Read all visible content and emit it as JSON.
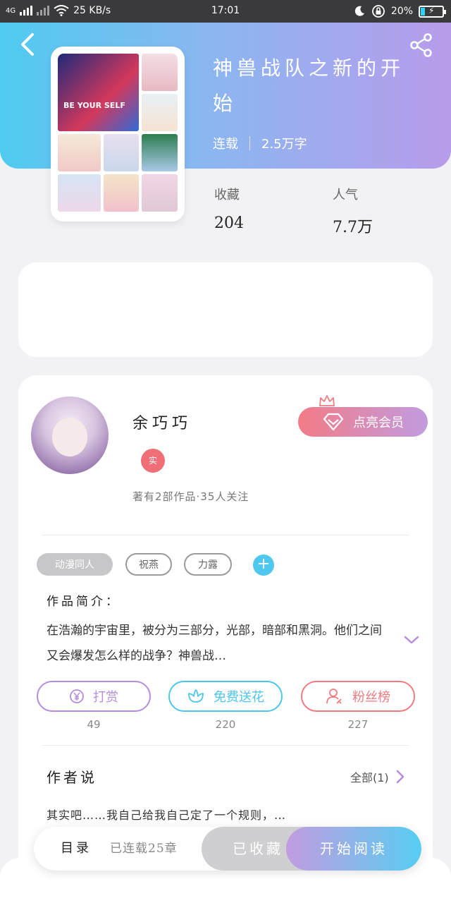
{
  "status_bar": {
    "network": "4G",
    "speed": "25 KB/s",
    "time": "17:01",
    "battery": "20%",
    "battery_level": 0.2
  },
  "book": {
    "title": "神兽战队之新的开始",
    "status": "连载",
    "word_count": "2.5万字",
    "cover_text": "BE YOUR SELF"
  },
  "stats": {
    "favorites_label": "收藏",
    "favorites_value": "204",
    "popularity_label": "人气",
    "popularity_value": "7.7万"
  },
  "author": {
    "name": "余巧巧",
    "badge": "实",
    "summary": "著有2部作品·35人关注",
    "vip_button": "点亮会员"
  },
  "tags": [
    "动漫同人",
    "祝燕",
    "力露"
  ],
  "intro": {
    "label": "作品简介：",
    "text": "在浩瀚的宇宙里，被分为三部分，光部，暗部和黑洞。他们之间又会爆发怎么样的战争？神兽战…"
  },
  "actions": [
    {
      "label": "打赏",
      "count": "49",
      "color": "#b58ddc",
      "icon": "yen-coin-icon"
    },
    {
      "label": "免费送花",
      "count": "220",
      "color": "#4cc6ea",
      "icon": "flower-icon"
    },
    {
      "label": "粉丝榜",
      "count": "227",
      "color": "#ef7b82",
      "icon": "fan-icon"
    }
  ],
  "author_says": {
    "title": "作者说",
    "all_label": "全部(1)",
    "text": "其实吧……我自己给我自己定了一个规则，…"
  },
  "bottom_bar": {
    "toc": "目录",
    "chapters": "已连载25章",
    "collected": "已收藏",
    "read": "开始阅读"
  },
  "colors": {
    "accent_blue": "#4fcbf0",
    "accent_purple": "#b89cec",
    "accent_red": "#f06f76"
  }
}
